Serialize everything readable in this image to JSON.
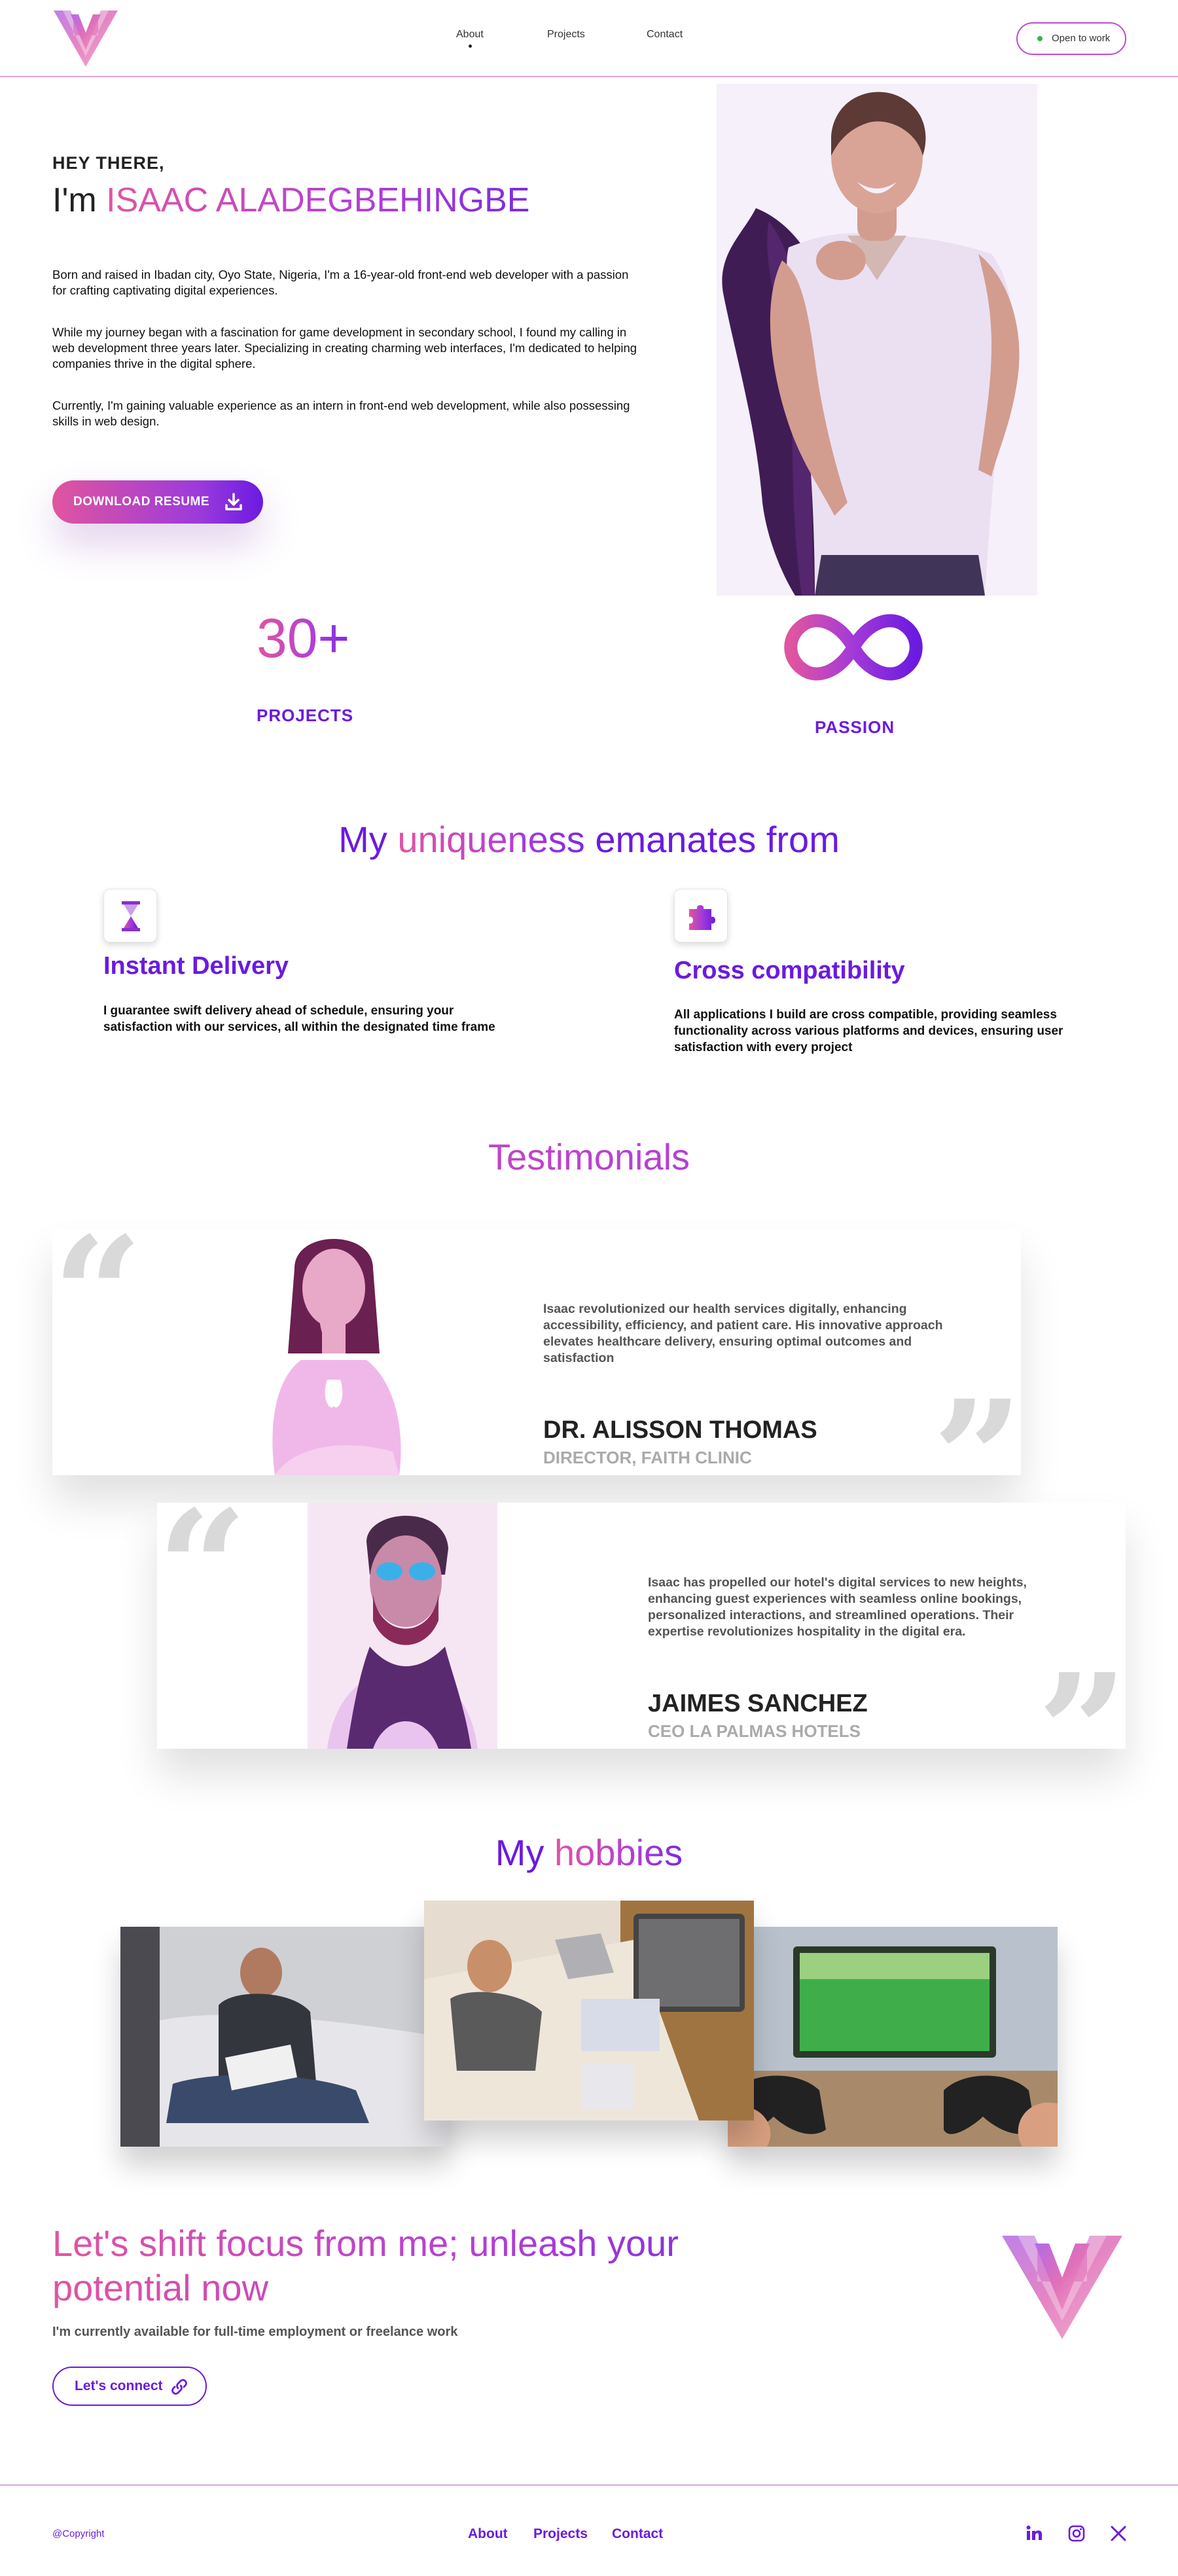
{
  "header": {
    "nav": [
      {
        "label": "About"
      },
      {
        "label": "Projects"
      },
      {
        "label": "Contact"
      }
    ],
    "status_button": "Open to work"
  },
  "hero": {
    "greeting": "HEY THERE,",
    "im": "I'm",
    "name": "ISAAC ALADEGBEHINGBE",
    "paragraphs": [
      "Born and raised in Ibadan city, Oyo State, Nigeria, I'm a 16-year-old front-end web developer with a passion for crafting captivating digital experiences.",
      "While my journey began with a fascination for game development in secondary school, I found my calling in web development three years later. Specializing in creating charming web interfaces, I'm dedicated to helping companies thrive in the digital sphere.",
      "Currently, I'm gaining valuable experience as an intern in front-end web development, while also possessing skills in web design."
    ],
    "download_button": "DOWNLOAD RESUME"
  },
  "stats": [
    {
      "value": "30+",
      "label": "PROJECTS"
    },
    {
      "value": "∞",
      "label": "PASSION"
    }
  ],
  "uniqueness": {
    "title_start": "My",
    "title_highlight": "uniqueness",
    "title_end": "emanates from",
    "features": [
      {
        "title": "Instant Delivery",
        "text": "I guarantee swift delivery ahead of schedule,  ensuring your satisfaction with our services, all within the designated time frame",
        "icon": "hourglass-icon"
      },
      {
        "title": "Cross compatibility",
        "text": "All applications I build are cross compatible, providing seamless functionality across various platforms and devices, ensuring user satisfaction with every project",
        "icon": "puzzle-icon"
      }
    ]
  },
  "testimonials": {
    "title": "Testimonials",
    "items": [
      {
        "text": "Isaac revolutionized our health services digitally, enhancing accessibility, efficiency, and patient care. His innovative approach elevates healthcare delivery, ensuring optimal outcomes and satisfaction",
        "name": "DR. ALISSON THOMAS",
        "role": "DIRECTOR, FAITH CLINIC"
      },
      {
        "text": "Isaac has propelled our hotel's digital services to new heights, enhancing guest experiences with seamless online bookings, personalized interactions, and streamlined operations. Their expertise revolutionizes hospitality in the digital era.",
        "name": "JAIMES SANCHEZ",
        "role": "CEO LA PALMAS HOTELS"
      }
    ]
  },
  "hobbies": {
    "title_start": "My",
    "title_highlight": "hobbies"
  },
  "cta": {
    "title": "Let's shift focus from me; unleash your potential now",
    "subtitle": "I'm currently available for full-time employment or freelance work",
    "button": "Let's connect"
  },
  "footer": {
    "copyright": "@Copyright",
    "nav": [
      {
        "label": "About"
      },
      {
        "label": "Projects"
      },
      {
        "label": "Contact"
      }
    ],
    "social": [
      "linkedin-icon",
      "instagram-icon",
      "x-icon"
    ]
  },
  "colors": {
    "accent_purple": "#6a1be0",
    "accent_pink": "#e0559f",
    "border_pink": "#d8a6dc"
  }
}
